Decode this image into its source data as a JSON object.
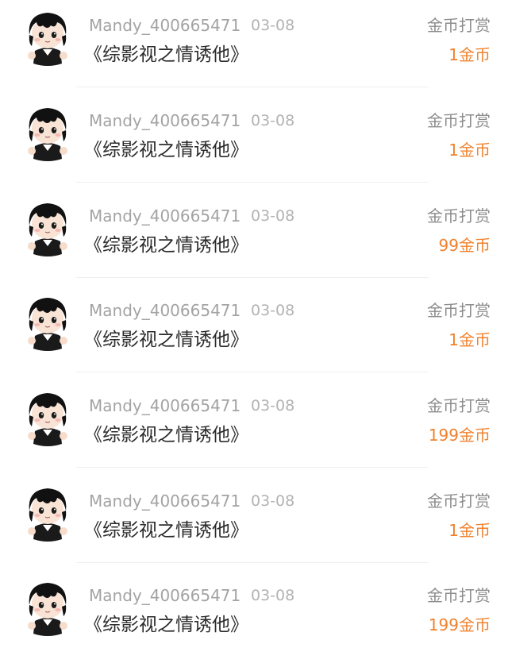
{
  "items": [
    {
      "username": "Mandy_400665471",
      "date": "03-08",
      "title": "《综影视之情诱他》",
      "type": "金币打赏",
      "amount": "1金币"
    },
    {
      "username": "Mandy_400665471",
      "date": "03-08",
      "title": "《综影视之情诱他》",
      "type": "金币打赏",
      "amount": "1金币"
    },
    {
      "username": "Mandy_400665471",
      "date": "03-08",
      "title": "《综影视之情诱他》",
      "type": "金币打赏",
      "amount": "99金币"
    },
    {
      "username": "Mandy_400665471",
      "date": "03-08",
      "title": "《综影视之情诱他》",
      "type": "金币打赏",
      "amount": "1金币"
    },
    {
      "username": "Mandy_400665471",
      "date": "03-08",
      "title": "《综影视之情诱他》",
      "type": "金币打赏",
      "amount": "199金币"
    },
    {
      "username": "Mandy_400665471",
      "date": "03-08",
      "title": "《综影视之情诱他》",
      "type": "金币打赏",
      "amount": "1金币"
    },
    {
      "username": "Mandy_400665471",
      "date": "03-08",
      "title": "《综影视之情诱他》",
      "type": "金币打赏",
      "amount": "199金币"
    }
  ],
  "colors": {
    "amount": "#f0822e",
    "username": "#a3a3a3",
    "title": "#2b2b2b"
  },
  "icons": {
    "avatar": "chibi-avatar-icon"
  }
}
